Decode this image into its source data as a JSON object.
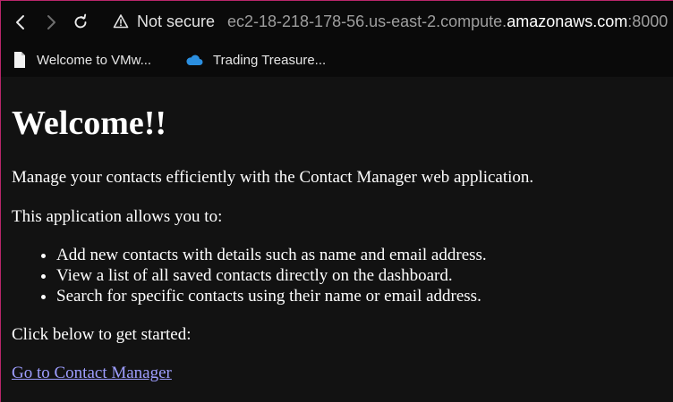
{
  "browser": {
    "security_label": "Not secure",
    "url": {
      "subdomain": "ec2-18-218-178-56.us-east-2.compute.",
      "domain": "amazonaws.com",
      "port": ":8000"
    },
    "bookmarks": [
      {
        "label": "Welcome to VMw...",
        "icon": "page-icon"
      },
      {
        "label": "Trading Treasure...",
        "icon": "cloud-icon"
      }
    ]
  },
  "page": {
    "title": "Welcome!!",
    "intro": "Manage your contacts efficiently with the Contact Manager web application.",
    "lead": "This application allows you to:",
    "features": [
      "Add new contacts with details such as name and email address.",
      "View a list of all saved contacts directly on the dashboard.",
      "Search for specific contacts using their name or email address."
    ],
    "cta_text": "Click below to get started:",
    "cta_link": "Go to Contact Manager"
  },
  "colors": {
    "page_background": "#121212",
    "chrome_background": "#0a0a0a",
    "link": "#9e9eff",
    "window_edge": "#b8266a"
  }
}
